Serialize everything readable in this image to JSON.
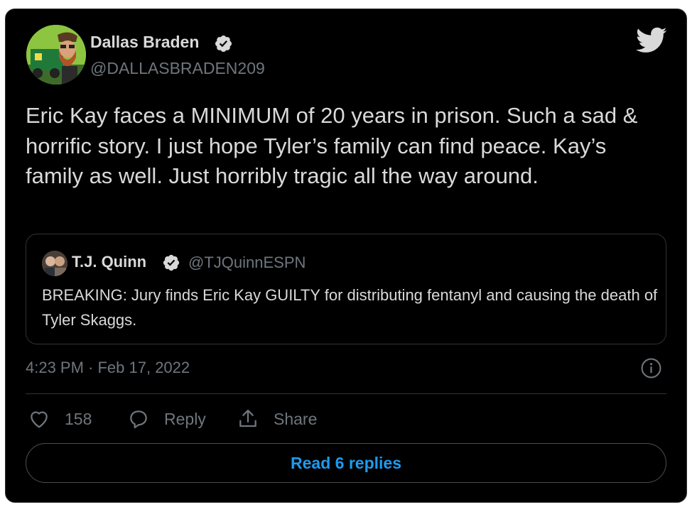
{
  "author": {
    "name": "Dallas Braden",
    "handle": "@DALLASBRADEN209",
    "verified": true
  },
  "tweet": {
    "text": "Eric Kay faces a MINIMUM of 20 years in prison. Such a sad & horrific story. I just hope Tyler’s family can find peace. Kay’s family as well. Just horribly tragic all the way around."
  },
  "quoted_tweet": {
    "author_name": "T.J. Quinn",
    "author_handle": "@TJQuinnESPN",
    "verified": true,
    "text": "BREAKING: Jury finds Eric Kay GUILTY for distributing fentanyl and causing the death of Tyler Skaggs."
  },
  "timestamp": "4:23 PM · Feb 17, 2022",
  "actions": {
    "like_count": "158",
    "reply_label": "Reply",
    "share_label": "Share"
  },
  "read_replies_label": "Read 6 replies",
  "colors": {
    "background": "#000000",
    "text": "#d9d9d9",
    "muted": "#6e767d",
    "accent": "#1d9bf0",
    "border": "#2f3336"
  },
  "icons": {
    "logo": "twitter-bird-icon",
    "verified": "verified-badge-icon",
    "info": "info-icon",
    "like": "heart-icon",
    "reply": "speech-bubble-icon",
    "share": "share-upload-icon"
  }
}
